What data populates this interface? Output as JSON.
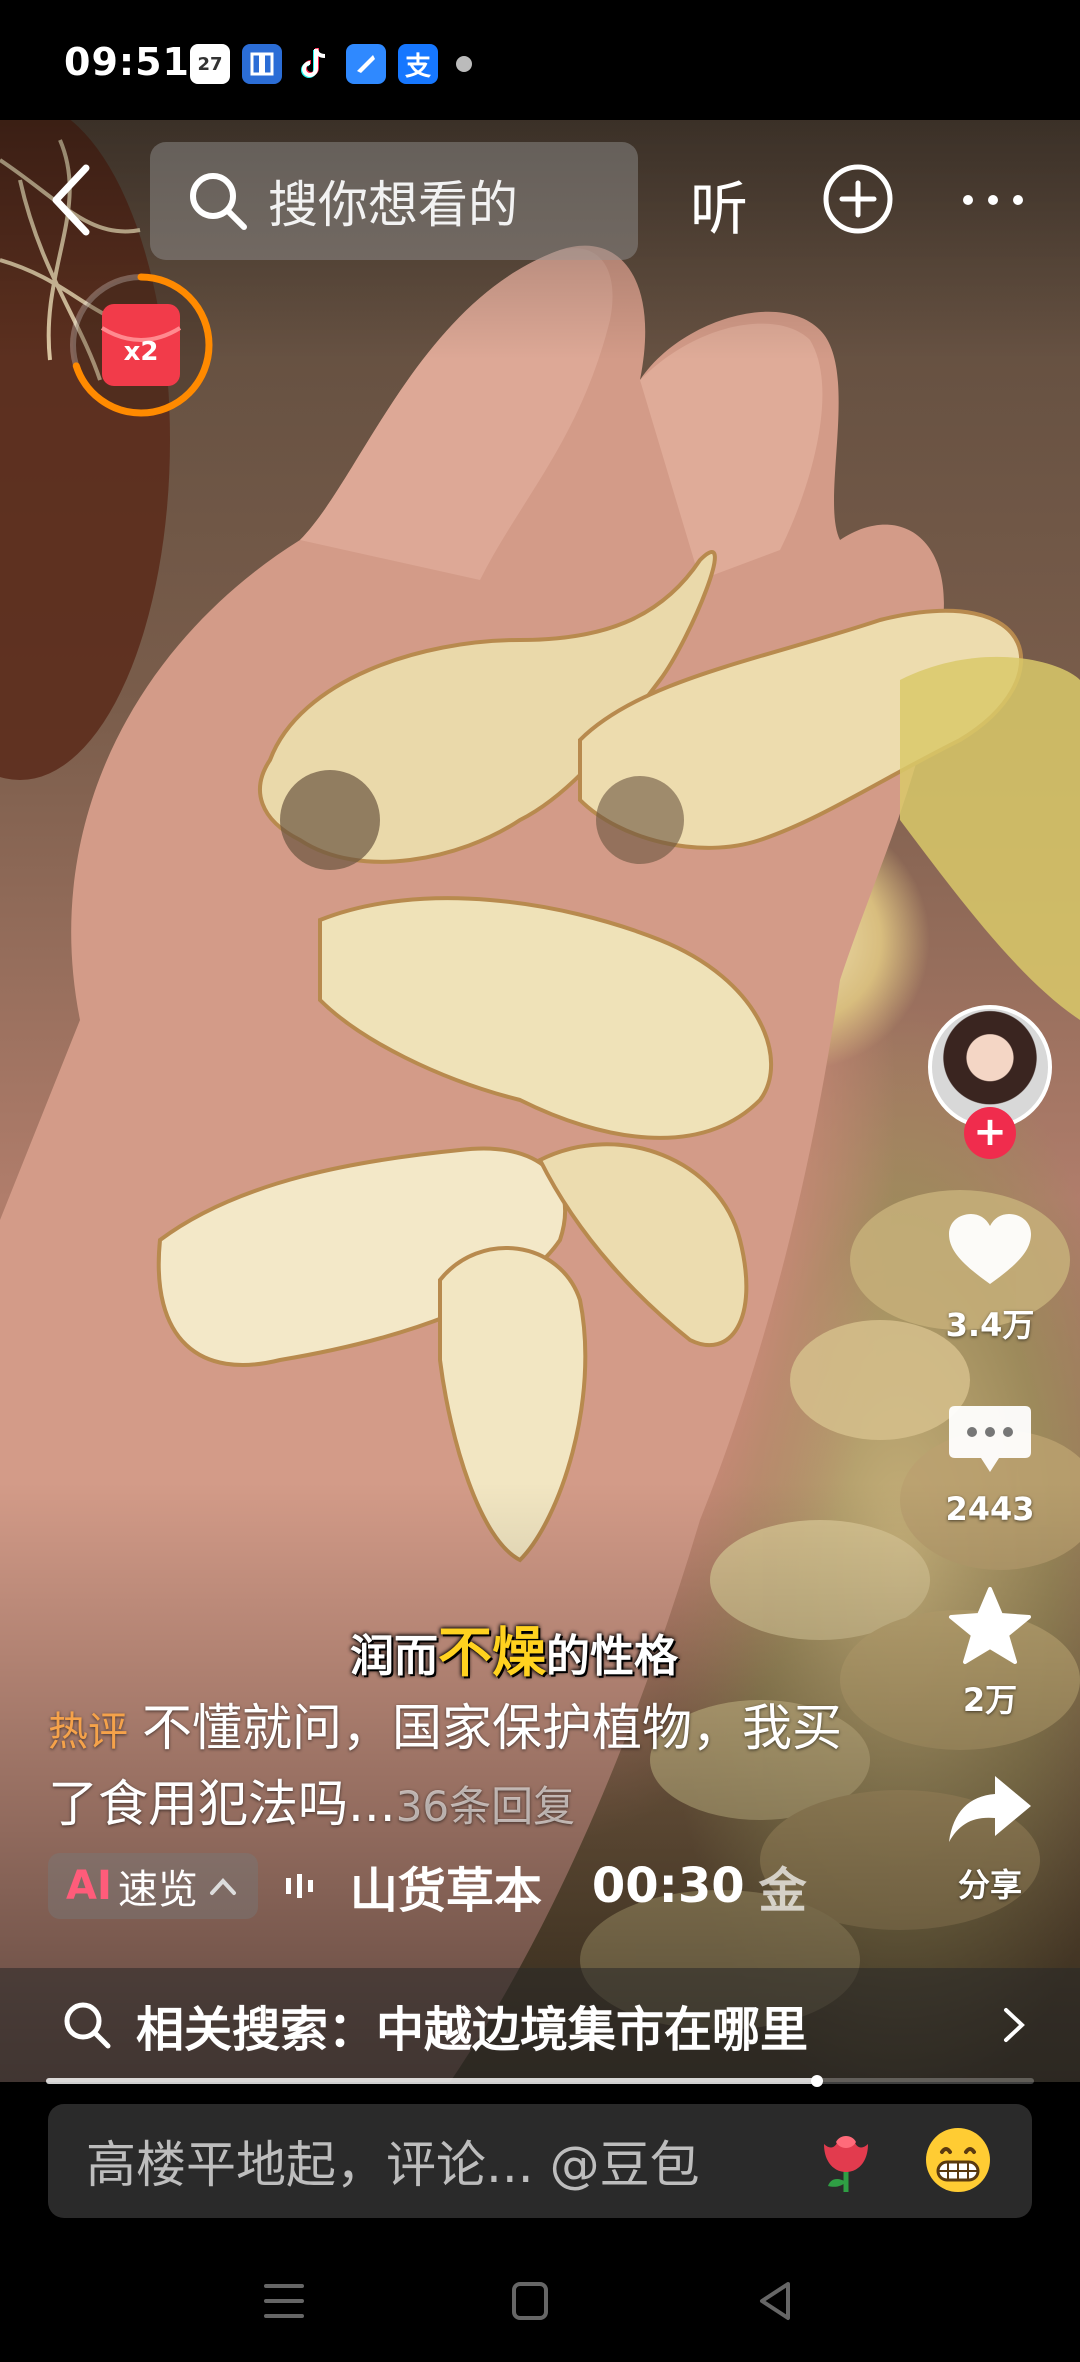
{
  "status_bar": {
    "time": "09:51",
    "calendar_day": "27",
    "icons": [
      "calendar-icon",
      "bank-app-icon",
      "tiktok-icon",
      "blue-app-icon",
      "alipay-icon",
      "notification-dot-icon"
    ],
    "alipay_glyph": "支"
  },
  "top_bar": {
    "search_placeholder": "搜你想看的",
    "listen_label": "听"
  },
  "red_packet": {
    "multiplier": "x2",
    "progress": 0.7
  },
  "right_rail": {
    "likes": "3.4万",
    "comments": "2443",
    "favorites": "2万",
    "share_label": "分享"
  },
  "video": {
    "subtitle_pre": "润而",
    "subtitle_highlight": "不燥",
    "subtitle_post": "的性格"
  },
  "hot_comment": {
    "tag": "热评",
    "text": "不懂就问，国家保护植物，我买了食用犯法吗...",
    "reply_count": "36条回复"
  },
  "info_row": {
    "ai_label": "AI",
    "summary_label": "速览",
    "author": "山货草本",
    "duration": "00:30",
    "coin_label": "金"
  },
  "related_search": {
    "text": "相关搜索：中越边境集市在哪里"
  },
  "progress": {
    "fraction": 0.78
  },
  "comment_bar": {
    "placeholder": "高楼平地起，评论... @豆包"
  },
  "colors": {
    "like_red": "#f02c4d",
    "highlight_yellow": "#ffd21f",
    "hot_tag_orange": "#f5a24a",
    "packet_ring_orange": "#ff8a00"
  }
}
